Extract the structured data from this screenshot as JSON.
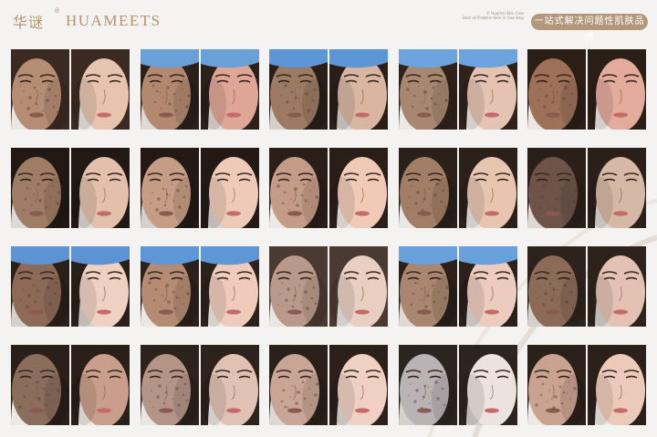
{
  "brand": {
    "name_cn": "华谜",
    "registered": "®",
    "name_en": "HUAMEETS",
    "fine_print": [
      "© Huamei Skin Care",
      "Deal all Problem Skin in One Stop"
    ],
    "slogan": "一站式解决问题性肌肤品牌"
  },
  "cases": [
    {
      "before_skin": "#b58d73",
      "after_skin": "#e7c4b0",
      "hair": "#3a2a22",
      "cap": null
    },
    {
      "before_skin": "#b2896f",
      "after_skin": "#dfa595",
      "hair": "#2b201a",
      "cap": "#6aa0d8"
    },
    {
      "before_skin": "#9c7a64",
      "after_skin": "#d8b6a2",
      "hair": "#2a1f18",
      "cap": "#5c96d6"
    },
    {
      "before_skin": "#a88770",
      "after_skin": "#e5c3b2",
      "hair": "#2e221b",
      "cap": "#6da3dc"
    },
    {
      "before_skin": "#9e7058",
      "after_skin": "#e3ab9c",
      "hair": "#2b1e17",
      "cap": null
    },
    {
      "before_skin": "#9f7c64",
      "after_skin": "#e2c0ac",
      "hair": "#221914",
      "cap": null
    },
    {
      "before_skin": "#c59c84",
      "after_skin": "#f0cab8",
      "hair": "#231a15",
      "cap": null
    },
    {
      "before_skin": "#c49b86",
      "after_skin": "#f0cab7",
      "hair": "#2a1e18",
      "cap": null
    },
    {
      "before_skin": "#a27e67",
      "after_skin": "#e8c5b1",
      "hair": "#2c211a",
      "cap": null
    },
    {
      "before_skin": "#6e5448",
      "after_skin": "#d6b8a6",
      "hair": "#2a2019",
      "cap": null
    },
    {
      "before_skin": "#8d6a58",
      "after_skin": "#efd1c2",
      "hair": "#2a201a",
      "cap": "#5d93d3"
    },
    {
      "before_skin": "#b48c74",
      "after_skin": "#eecbbb",
      "hair": "#2c211b",
      "cap": "#5e97d5"
    },
    {
      "before_skin": "#b99a8a",
      "after_skin": "#e8cfc2",
      "hair": "#4a3a32",
      "cap": null
    },
    {
      "before_skin": "#a9866f",
      "after_skin": "#ecccbe",
      "hair": "#2b201a",
      "cap": "#68a0db"
    },
    {
      "before_skin": "#8b6a58",
      "after_skin": "#e4c2b3",
      "hair": "#2e231c",
      "cap": null
    },
    {
      "before_skin": "#8b6d5c",
      "after_skin": "#c99e8c",
      "hair": "#2a1f19",
      "cap": null
    },
    {
      "before_skin": "#b49486",
      "after_skin": "#e1c1b4",
      "hair": "#2d221c",
      "cap": null
    },
    {
      "before_skin": "#c8a594",
      "after_skin": "#f0d0c2",
      "hair": "#2b201a",
      "cap": null
    },
    {
      "before_skin": "#b9b3b6",
      "after_skin": "#ece2df",
      "hair": "#2c2420",
      "cap": null
    },
    {
      "before_skin": "#c9a290",
      "after_skin": "#eccab9",
      "hair": "#2c201a",
      "cap": null
    }
  ]
}
